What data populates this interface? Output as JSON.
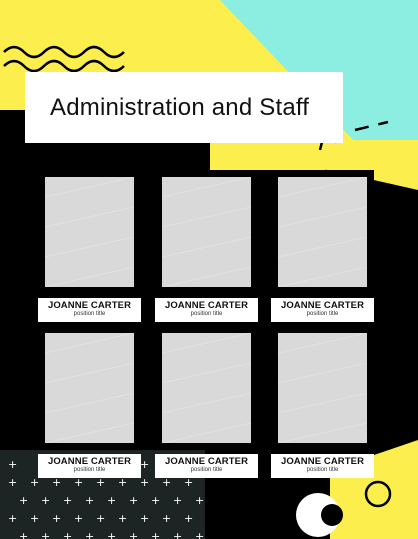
{
  "page": {
    "title": "Administration and Staff",
    "colors": {
      "yellow": "#fcee4c",
      "cyan": "#8ceee0",
      "black": "#000000",
      "white": "#ffffff",
      "photo": "#d9d9d9"
    }
  },
  "staff": [
    {
      "name": "JOANNE CARTER",
      "position": "position title"
    },
    {
      "name": "JOANNE CARTER",
      "position": "position title"
    },
    {
      "name": "JOANNE CARTER",
      "position": "position title"
    },
    {
      "name": "JOANNE CARTER",
      "position": "position title"
    },
    {
      "name": "JOANNE CARTER",
      "position": "position title"
    },
    {
      "name": "JOANNE CARTER",
      "position": "position title"
    }
  ]
}
